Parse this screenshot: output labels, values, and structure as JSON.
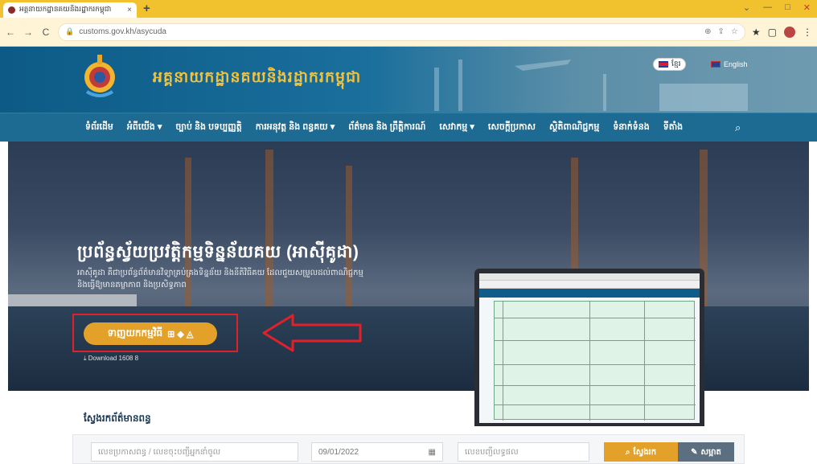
{
  "browser": {
    "tab_title": "អគ្គនាយកដ្ឋានគយនិងរដ្ឋាករកម្ពុជា",
    "tab_close": "×",
    "new_tab": "+",
    "url": "customs.gov.kh/asycuda",
    "nav_back": "←",
    "nav_forward": "→",
    "nav_reload": "C",
    "window_controls": [
      "⌄",
      "—",
      "□",
      "✕"
    ]
  },
  "site": {
    "title": "អគ្គនាយកដ្ឋានគយនិងរដ្ឋាករកម្ពុជា",
    "lang_km": "ខ្មែរ",
    "lang_en": "English",
    "nav": [
      "ទំព័រដើម",
      "អំពីយើង ▾",
      "ច្បាប់ និង បទប្បញ្ញត្តិ",
      "ការអនុវត្ត និង ពន្ធគយ ▾",
      "ព័ត៌មាន និង ព្រឹត្តិការណ៍",
      "សេវាកម្ម ▾",
      "សេចក្តីប្រកាស",
      "ស្ថិតិពាណិជ្ជកម្ម",
      "ទំនាក់ទំនង",
      "ទីតាំង"
    ],
    "search_icon": "search-icon"
  },
  "hero": {
    "title": "ប្រព័ន្ធស្វ័យប្រវត្តិកម្មទិន្នន័យគយ (អាស៊ីគូដា)",
    "subtitle_line1": "អាស៊ីគូដា គឺជាប្រព័ន្ធព័ត៌មានវិទ្យាគ្រប់គ្រងទិន្នន័យ និងនីតិវិធីគយ ដែលជួយសម្រួលដល់ពាណិជ្ជកម្ម",
    "subtitle_line2": "និងធ្វើឱ្យមានតម្លាភាព និងប្រសិទ្ធភាព",
    "download_label": "ទាញយកកម្មវិធី",
    "download_os": "⊞ ◆ ◬",
    "download_note": "⤓ Download 1608 8"
  },
  "search": {
    "title": "ស្វែងរកព័ត៌មានពន្ធ",
    "field1_placeholder": "លេខប្រកាសពន្ធ / លេខចុះបញ្ជីអ្នកនាំចូល",
    "field2_value": "09/01/2022",
    "field3_placeholder": "លេខបញ្ជីលទ្ធផល",
    "search_button": "ស្វែងរក",
    "clear_button": "សម្អាត"
  },
  "colors": {
    "accent": "#e3a12a",
    "header_blue": "#0d5a86",
    "highlight_red": "#e2202a",
    "title_gold": "#f3c23b"
  }
}
